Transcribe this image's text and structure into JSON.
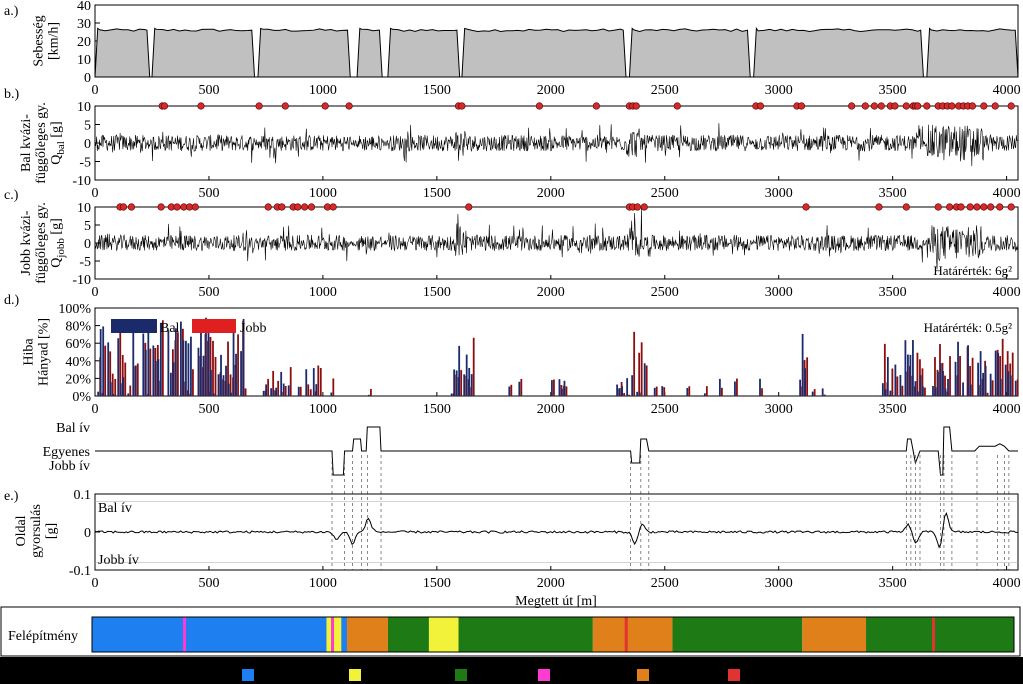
{
  "colors": {
    "fill": "#c0c0c0",
    "bal": "#1b2a6b",
    "jobb": "#8b0f0f",
    "jobb_legend": "#e02020",
    "marker": "#d42a2a",
    "blue": "#1e7ff0",
    "yellow": "#f2f23a",
    "green": "#1e7a14",
    "magenta": "#ff3ad2",
    "orange": "#e0801a",
    "red": "#e23232"
  },
  "panels": {
    "a": {
      "tag": "a.)",
      "ylabel": [
        "Sebesség",
        "[km/h]"
      ]
    },
    "b": {
      "tag": "b.)",
      "ylabel": [
        "Bal kvázi-",
        "függőleges gy.",
        "Q_bal [g]"
      ]
    },
    "c": {
      "tag": "c.)",
      "ylabel": [
        "Jobb kvázi-",
        "függőleges gy.",
        "Q_jobb [g]"
      ],
      "annotation": "Határérték: 6g²"
    },
    "d": {
      "tag": "d.)",
      "ylabel": [
        "Hiba",
        "Hányad [%]"
      ],
      "legend": [
        "Bal",
        "Jobb"
      ],
      "annotation": "Határérték: 0.5g²"
    },
    "curve": {
      "labels": [
        "Bal ív",
        "Egyenes",
        "Jobb ív"
      ]
    },
    "e": {
      "tag": "e.)",
      "ylabel": [
        "Oldal",
        "gyorsulás",
        "[g]"
      ],
      "inner_top": "Bal ív",
      "inner_bottom": "Jobb ív"
    },
    "f": {
      "ylabel": "Felépítmény"
    }
  },
  "xlabel": "Megtett út [m]",
  "chart_data": [
    {
      "panel": "a",
      "type": "area",
      "xlim": [
        0,
        4050
      ],
      "ylim": [
        0,
        40
      ],
      "yticks": [
        0,
        10,
        20,
        30,
        40
      ],
      "xticks": [
        0,
        500,
        1000,
        1500,
        2000,
        2500,
        3000,
        3500,
        4000
      ],
      "segments": [
        [
          0,
          240
        ],
        [
          250,
          700
        ],
        [
          715,
          1120
        ],
        [
          1150,
          1260
        ],
        [
          1285,
          1600
        ],
        [
          1610,
          2330
        ],
        [
          2345,
          2875
        ],
        [
          2890,
          3635
        ],
        [
          3650,
          4050
        ]
      ],
      "plateau": 26
    },
    {
      "panel": "b",
      "type": "line",
      "xlim": [
        0,
        4050
      ],
      "ylim": [
        -10,
        10
      ],
      "yticks": [
        -10,
        -5,
        0,
        5,
        10
      ],
      "markers_x": [
        295,
        305,
        465,
        720,
        835,
        1010,
        1115,
        1595,
        1610,
        1950,
        2200,
        2345,
        2360,
        2375,
        2555,
        2900,
        2920,
        3080,
        3100,
        3320,
        3380,
        3420,
        3450,
        3490,
        3510,
        3560,
        3590,
        3600,
        3610,
        3650,
        3700,
        3720,
        3740,
        3760,
        3790,
        3810,
        3830,
        3850,
        3900,
        3950,
        4020
      ]
    },
    {
      "panel": "c",
      "type": "line",
      "xlim": [
        0,
        4050
      ],
      "ylim": [
        -10,
        10
      ],
      "yticks": [
        -10,
        -5,
        0,
        5,
        10
      ],
      "markers_x": [
        110,
        125,
        160,
        290,
        335,
        360,
        390,
        415,
        440,
        760,
        800,
        820,
        870,
        890,
        920,
        950,
        1020,
        1045,
        1640,
        2345,
        2360,
        2380,
        2410,
        3120,
        3440,
        3560,
        3700,
        3750,
        3780,
        3800,
        3840,
        3870,
        3900,
        3930,
        3970,
        4020
      ]
    },
    {
      "panel": "d",
      "type": "bar",
      "xlim": [
        0,
        4050
      ],
      "ylim": [
        0,
        100
      ],
      "yticks": [
        0,
        20,
        40,
        60,
        80,
        100
      ],
      "ytick_labels": [
        "0%",
        "20%",
        "40%",
        "60%",
        "80%",
        "100%"
      ],
      "series": [
        {
          "name": "Bal"
        },
        {
          "name": "Jobb"
        }
      ]
    },
    {
      "panel": "curve",
      "type": "line",
      "xlim": [
        0,
        4050
      ],
      "steps": [
        [
          0,
          0
        ],
        [
          1040,
          0
        ],
        [
          1045,
          -1
        ],
        [
          1090,
          -1
        ],
        [
          1095,
          0
        ],
        [
          1130,
          0
        ],
        [
          1135,
          0.5
        ],
        [
          1165,
          0.5
        ],
        [
          1170,
          0
        ],
        [
          1190,
          0
        ],
        [
          1195,
          1
        ],
        [
          1250,
          1
        ],
        [
          1255,
          0
        ],
        [
          2350,
          0
        ],
        [
          2355,
          -0.5
        ],
        [
          2390,
          -0.5
        ],
        [
          2395,
          0.5
        ],
        [
          2420,
          0.5
        ],
        [
          2430,
          0
        ],
        [
          3560,
          0
        ],
        [
          3565,
          0.5
        ],
        [
          3580,
          0.5
        ],
        [
          3590,
          0
        ],
        [
          3600,
          -0.5
        ],
        [
          3620,
          0
        ],
        [
          3700,
          0
        ],
        [
          3710,
          -1
        ],
        [
          3720,
          -1
        ],
        [
          3725,
          1
        ],
        [
          3750,
          1
        ],
        [
          3760,
          0
        ],
        [
          3860,
          0
        ],
        [
          3880,
          0.2
        ],
        [
          3950,
          0.2
        ],
        [
          3970,
          0.3
        ],
        [
          3990,
          0.2
        ],
        [
          4010,
          0
        ],
        [
          4050,
          0
        ]
      ]
    },
    {
      "panel": "e",
      "type": "line",
      "xlim": [
        0,
        4050
      ],
      "ylim": [
        -0.1,
        0.1
      ],
      "yticks": [
        -0.1,
        0,
        0.1
      ],
      "ytick_labels": [
        "-0.1",
        "0",
        "0.1"
      ],
      "peaks": [
        [
          1060,
          -0.02
        ],
        [
          1130,
          -0.03
        ],
        [
          1200,
          0.035
        ],
        [
          2370,
          -0.03
        ],
        [
          2400,
          0.02
        ],
        [
          3570,
          0.02
        ],
        [
          3600,
          -0.03
        ],
        [
          3710,
          -0.05
        ],
        [
          3730,
          0.06
        ]
      ]
    },
    {
      "panel": "f",
      "type": "bar",
      "blocks": [
        [
          "blue",
          0,
          1030
        ],
        [
          "yellow",
          1030,
          1095
        ],
        [
          "blue",
          1095,
          1120
        ],
        [
          "orange",
          1120,
          1300
        ],
        [
          "green",
          1300,
          1480
        ],
        [
          "yellow",
          1480,
          1610
        ],
        [
          "green",
          1610,
          2200
        ],
        [
          "orange",
          2200,
          2550
        ],
        [
          "green",
          2550,
          3120
        ],
        [
          "orange",
          3120,
          3400
        ],
        [
          "green",
          3400,
          4050
        ]
      ],
      "stripes": [
        [
          "magenta",
          400
        ],
        [
          "magenta",
          1050
        ],
        [
          "red",
          2340
        ],
        [
          "red",
          3690
        ]
      ]
    }
  ],
  "legend_swatches": [
    "blue",
    "yellow",
    "green",
    "magenta",
    "orange",
    "red"
  ]
}
